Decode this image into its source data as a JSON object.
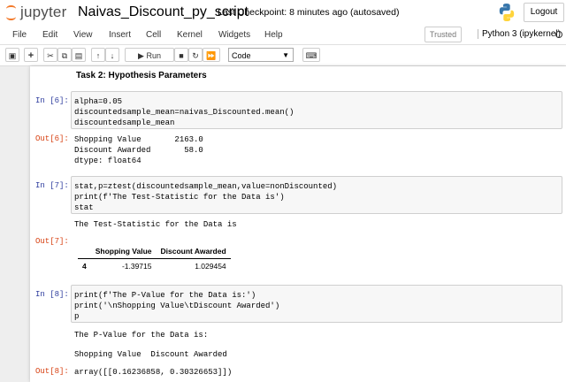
{
  "header": {
    "logo_text": "jupyter",
    "notebook_title": "Naivas_Discount_py_script",
    "checkpoint": "Last Checkpoint: 8 minutes ago",
    "autosave": "(autosaved)",
    "logout_label": "Logout"
  },
  "menu": [
    "File",
    "Edit",
    "View",
    "Insert",
    "Cell",
    "Kernel",
    "Widgets",
    "Help"
  ],
  "status": {
    "trusted_label": "Trusted",
    "kernel_label": "Python 3 (ipykernel)"
  },
  "toolbar": {
    "run_label": "Run",
    "cell_type": "Code",
    "icons": [
      "save-icon",
      "plus-icon",
      "cut-icon",
      "copy-icon",
      "paste-icon",
      "move-up-icon",
      "move-down-icon",
      "run-icon",
      "stop-icon",
      "restart-icon",
      "fast-forward-icon",
      "keyboard-icon"
    ]
  },
  "cells": {
    "markdown_heading": "Task 2: Hypothesis Parameters",
    "c6": {
      "in_prompt": "In [6]:",
      "out_prompt": "Out[6]:",
      "code_l1": "alpha=0.05",
      "code_l2": "discountedsample_mean=naivas_Discounted.mean()",
      "code_l3": "discountedsample_mean",
      "out_l1": "Shopping Value       2163.0",
      "out_l2": "Discount Awarded       58.0",
      "out_l3": "dtype: float64"
    },
    "c7": {
      "in_prompt": "In [7]:",
      "out_prompt": "Out[7]:",
      "code_l1": "stat,p=ztest(discountedsample_mean,value=nonDiscounted)",
      "code_l2": "print(f'The Test-Statistic for the Data is')",
      "code_l3": "stat",
      "stdout": "The Test-Statistic for the Data is",
      "table": {
        "headers": [
          "",
          "Shopping Value",
          "Discount Awarded"
        ],
        "row_index": "4",
        "row_values": [
          "-1.39715",
          "1.029454"
        ]
      }
    },
    "c8": {
      "in_prompt": "In [8]:",
      "out_prompt": "Out[8]:",
      "code_l1": "print(f'The P-Value for the Data is:')",
      "code_l2": "print('\\nShopping Value\\tDiscount Awarded')",
      "code_l3": "p",
      "stdout_l1": "The P-Value for the Data is:",
      "stdout_l2": "Shopping Value  Discount Awarded",
      "result": "array([[0.16236858, 0.30326653]])"
    }
  },
  "colors": {
    "jupyter_orange": "#f37726",
    "in_prompt": "#303f9f",
    "out_prompt": "#d84315"
  }
}
